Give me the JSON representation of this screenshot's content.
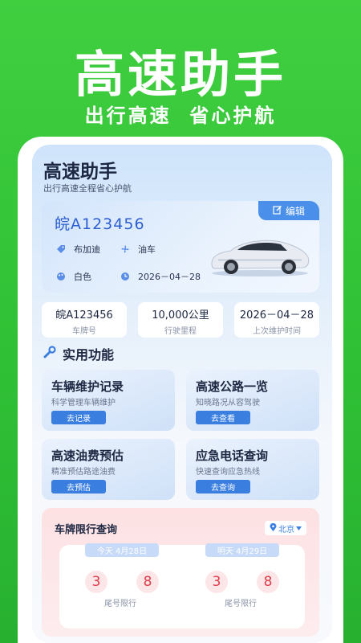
{
  "hero": {
    "title": "高速助手",
    "subtitle": "出行高速  省心护航"
  },
  "app": {
    "title": "高速助手",
    "subtitle": "出行高速全程省心护航"
  },
  "car": {
    "plate": "皖A123456",
    "edit_label": "编辑",
    "brand": "布加迪",
    "fuel": "油车",
    "color": "白色",
    "date": "2026－04－28"
  },
  "stats": [
    {
      "value": "皖A123456",
      "label": "车牌号"
    },
    {
      "value": "10,000公里",
      "label": "行驶里程"
    },
    {
      "value": "2026－04－28",
      "label": "上次维护时间"
    }
  ],
  "features_title": "实用功能",
  "features": [
    {
      "title": "车辆维护记录",
      "desc": "科学管理车辆维护",
      "button": "去记录"
    },
    {
      "title": "高速公路一览",
      "desc": "知晓路况从容驾驶",
      "button": "去查看"
    },
    {
      "title": "高速油费预估",
      "desc": "精准预估路途油费",
      "button": "去预估"
    },
    {
      "title": "应急电话查询",
      "desc": "快速查询应急热线",
      "button": "去查询"
    }
  ],
  "restriction": {
    "title": "车牌限行查询",
    "city": "北京",
    "days": [
      {
        "label": "今天 4月28日",
        "numbers": [
          "3",
          "8"
        ],
        "caption": "尾号限行"
      },
      {
        "label": "明天 4月29日",
        "numbers": [
          "3",
          "8"
        ],
        "caption": "尾号限行"
      }
    ]
  },
  "colors": {
    "brand_green": "#2fbf35",
    "accent_blue": "#3a7fe0",
    "plate_blue": "#2d5fd3",
    "restrict_red": "#e23c4a"
  }
}
